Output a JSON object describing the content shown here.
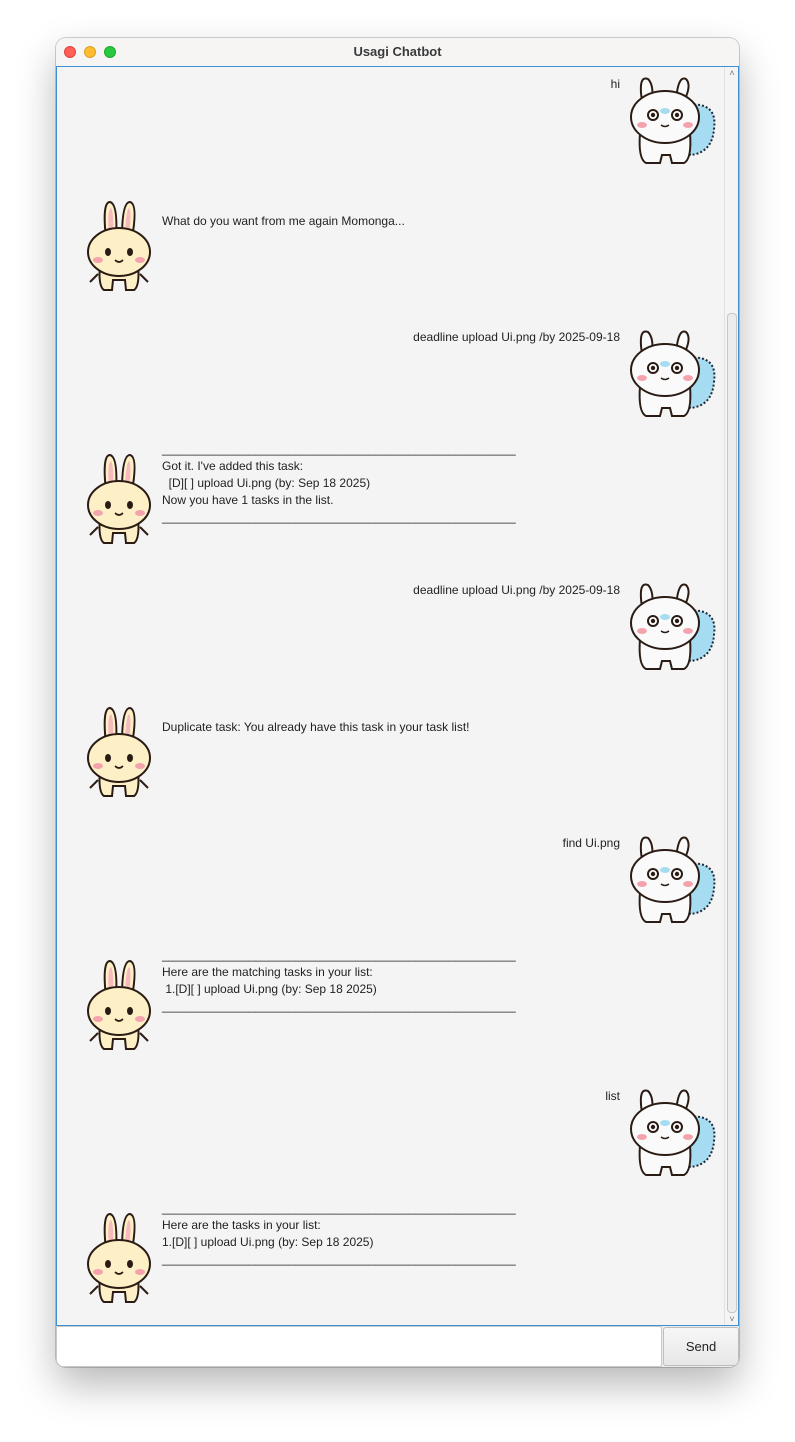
{
  "window": {
    "title": "Usagi Chatbot"
  },
  "dialog": [
    {
      "from": "user",
      "lines": [
        "hi"
      ]
    },
    {
      "from": "bot",
      "lines": [
        "What do you want from me again Momonga..."
      ]
    },
    {
      "from": "user",
      "lines": [
        "deadline upload Ui.png /by 2025-09-18"
      ]
    },
    {
      "from": "bot",
      "lines": [
        "_____________________________________________________",
        "Got it. I've added this task:",
        "  [D][ ] upload Ui.png (by: Sep 18 2025)",
        "Now you have 1 tasks in the list.",
        "_____________________________________________________"
      ]
    },
    {
      "from": "user",
      "lines": [
        "deadline upload Ui.png /by 2025-09-18"
      ]
    },
    {
      "from": "bot",
      "lines": [
        "Duplicate task: You already have this task in your task list!"
      ]
    },
    {
      "from": "user",
      "lines": [
        "find Ui.png"
      ]
    },
    {
      "from": "bot",
      "lines": [
        "_____________________________________________________",
        "Here are the matching tasks in your list:",
        " 1.[D][ ] upload Ui.png (by: Sep 18 2025)",
        "_____________________________________________________"
      ]
    },
    {
      "from": "user",
      "lines": [
        "list"
      ]
    },
    {
      "from": "bot",
      "lines": [
        "_____________________________________________________",
        "Here are the tasks in your list:",
        "1.[D][ ] upload Ui.png (by: Sep 18 2025)",
        "_____________________________________________________"
      ]
    }
  ],
  "input": {
    "value": "",
    "placeholder": ""
  },
  "send_button": {
    "label": "Send"
  },
  "avatars": {
    "user": "momonga-avatar",
    "bot": "usagi-avatar"
  },
  "colors": {
    "focus_border": "#3d8fd6",
    "pane_bg": "#f4f4f4",
    "user_avatar_fur": "#a6dcf2",
    "bot_avatar_fur": "#fdf0c6"
  }
}
